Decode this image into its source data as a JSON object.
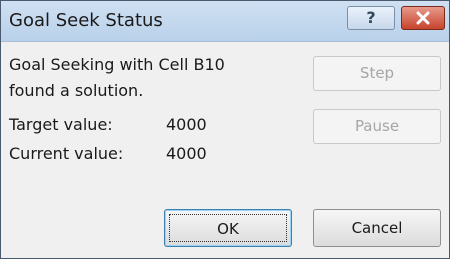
{
  "window": {
    "title": "Goal Seek Status",
    "help_label": "?",
    "close_icon": "close-x-icon",
    "accent_close": "#c7432e"
  },
  "status": {
    "message_line1": "Goal Seeking with Cell B10",
    "message_line2": "found a solution.",
    "target_label": "Target value:",
    "target_value": "4000",
    "current_label": "Current value:",
    "current_value": "4000"
  },
  "buttons": {
    "step": "Step",
    "pause": "Pause",
    "ok": "OK",
    "cancel": "Cancel"
  }
}
